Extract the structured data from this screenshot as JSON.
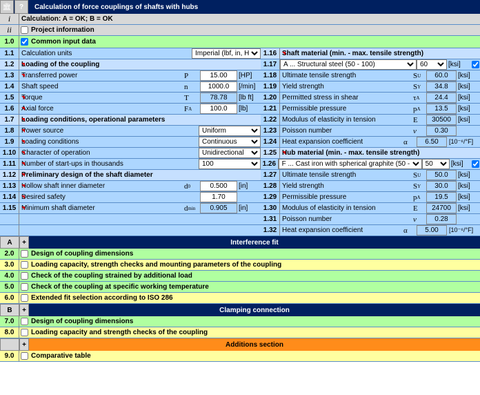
{
  "header": {
    "title": "Calculation of force couplings of shafts with hubs",
    "help": "?"
  },
  "status": {
    "i": "i",
    "ii": "ii",
    "calc": "Calculation:   A = OK;   B = OK",
    "proj": "Project information"
  },
  "s1": {
    "num": "1.0",
    "title": "Common input data",
    "checked": true
  },
  "r": {
    "1_1": {
      "n": "1.1",
      "lbl": "Calculation units",
      "sel": "Imperial (lbf, in, HP..)"
    },
    "1_2": {
      "n": "1.2",
      "lbl": "Loading of the coupling"
    },
    "1_3": {
      "n": "1.3",
      "lbl": "Transferred power",
      "sym": "P",
      "val": "15.00",
      "u": "[HP]"
    },
    "1_4": {
      "n": "1.4",
      "lbl": "Shaft speed",
      "sym": "n",
      "val": "1000.0",
      "u": "[/min]"
    },
    "1_5": {
      "n": "1.5",
      "lbl": "Torque",
      "sym": "T",
      "val": "78.78",
      "u": "[lb ft]"
    },
    "1_6": {
      "n": "1.6",
      "lbl": "Axial force",
      "sym": "F",
      "sub": "A",
      "val": "100.0",
      "u": "[lb]"
    },
    "1_7": {
      "n": "1.7",
      "lbl": "Loading conditions, operational parameters"
    },
    "1_8": {
      "n": "1.8",
      "lbl": "Power source",
      "sel": "Uniform"
    },
    "1_9": {
      "n": "1.9",
      "lbl": "Loading conditions",
      "sel": "Continuous"
    },
    "1_10": {
      "n": "1.10",
      "lbl": "Character of operation",
      "sel": "Unidirectional"
    },
    "1_11": {
      "n": "1.11",
      "lbl": "Number of start-ups in thousands",
      "sel": "100"
    },
    "1_12": {
      "n": "1.12",
      "lbl": "Preliminary design of the shaft diameter"
    },
    "1_13": {
      "n": "1.13",
      "lbl": "Hollow shaft inner diameter",
      "sym": "d",
      "sub": "0",
      "val": "0.500",
      "u": "[in]"
    },
    "1_14": {
      "n": "1.14",
      "lbl": "Desired safety",
      "val": "1.70"
    },
    "1_15": {
      "n": "1.15",
      "lbl": "Minimum shaft diameter",
      "sym": "d",
      "sub": "min",
      "val": "0.905",
      "u": "[in]"
    },
    "1_16": {
      "n": "1.16",
      "lbl": "Shaft material (min. - max. tensile strength)"
    },
    "1_17": {
      "n": "1.17",
      "sel": "A ... Structural steel  (50 - 100)",
      "val": "60",
      "u": "[ksi]"
    },
    "1_18": {
      "n": "1.18",
      "lbl": "Ultimate tensile strength",
      "sym": "S",
      "sub": "U",
      "val": "60.0",
      "u": "[ksi]"
    },
    "1_19": {
      "n": "1.19",
      "lbl": "Yield strength",
      "sym": "S",
      "sub": "Y",
      "val": "34.8",
      "u": "[ksi]"
    },
    "1_20": {
      "n": "1.20",
      "lbl": "Permitted stress in shear",
      "sym": "τ",
      "sub": "A",
      "val": "24.4",
      "u": "[ksi]"
    },
    "1_21": {
      "n": "1.21",
      "lbl": "Permissible pressure",
      "sym": "p",
      "sub": "A",
      "val": "13.5",
      "u": "[ksi]"
    },
    "1_22": {
      "n": "1.22",
      "lbl": "Modulus of elasticity in tension",
      "sym": "E",
      "val": "30500",
      "u": "[ksi]"
    },
    "1_23": {
      "n": "1.23",
      "lbl": "Poisson number",
      "sym": "ν",
      "val": "0.30"
    },
    "1_24": {
      "n": "1.24",
      "lbl": "Heat expansion coefficient",
      "sym": "α",
      "val": "6.50",
      "u": "[10⁻⁶/°F]"
    },
    "1_25": {
      "n": "1.25",
      "lbl": "Hub material (min. - max. tensile strength)"
    },
    "1_26": {
      "n": "1.26",
      "sel": "F ... Cast iron with spherical graphite  (50 -",
      "val": "50",
      "u": "[ksi]"
    },
    "1_27": {
      "n": "1.27",
      "lbl": "Ultimate tensile strength",
      "sym": "S",
      "sub": "U",
      "val": "50.0",
      "u": "[ksi]"
    },
    "1_28": {
      "n": "1.28",
      "lbl": "Yield strength",
      "sym": "S",
      "sub": "Y",
      "val": "30.0",
      "u": "[ksi]"
    },
    "1_29": {
      "n": "1.29",
      "lbl": "Permissible pressure",
      "sym": "p",
      "sub": "A",
      "val": "19.5",
      "u": "[ksi]"
    },
    "1_30": {
      "n": "1.30",
      "lbl": "Modulus of elasticity in tension",
      "sym": "E",
      "val": "24700",
      "u": "[ksi]"
    },
    "1_31": {
      "n": "1.31",
      "lbl": "Poisson number",
      "sym": "ν",
      "val": "0.28"
    },
    "1_32": {
      "n": "1.32",
      "lbl": "Heat expansion coefficient",
      "sym": "α",
      "val": "5.00",
      "u": "[10⁻⁶/°F]"
    }
  },
  "sections": {
    "A": {
      "l": "A",
      "p": "+",
      "name": "Interference fit"
    },
    "2": {
      "n": "2.0",
      "t": "Design of coupling dimensions"
    },
    "3": {
      "n": "3.0",
      "t": "Loading capacity, strength checks and mounting parameters of the coupling"
    },
    "4": {
      "n": "4.0",
      "t": "Check of the coupling strained by additional load"
    },
    "5": {
      "n": "5.0",
      "t": "Check of the coupling at specific working temperature"
    },
    "6": {
      "n": "6.0",
      "t": "Extended fit selection according to ISO 286"
    },
    "B": {
      "l": "B",
      "p": "+",
      "name": "Clamping connection"
    },
    "7": {
      "n": "7.0",
      "t": "Design of coupling dimensions"
    },
    "8": {
      "n": "8.0",
      "t": "Loading capacity and strength checks of the coupling"
    },
    "Add": {
      "p": "+",
      "name": "Additions section"
    },
    "9": {
      "n": "9.0",
      "t": "Comparative table"
    }
  }
}
